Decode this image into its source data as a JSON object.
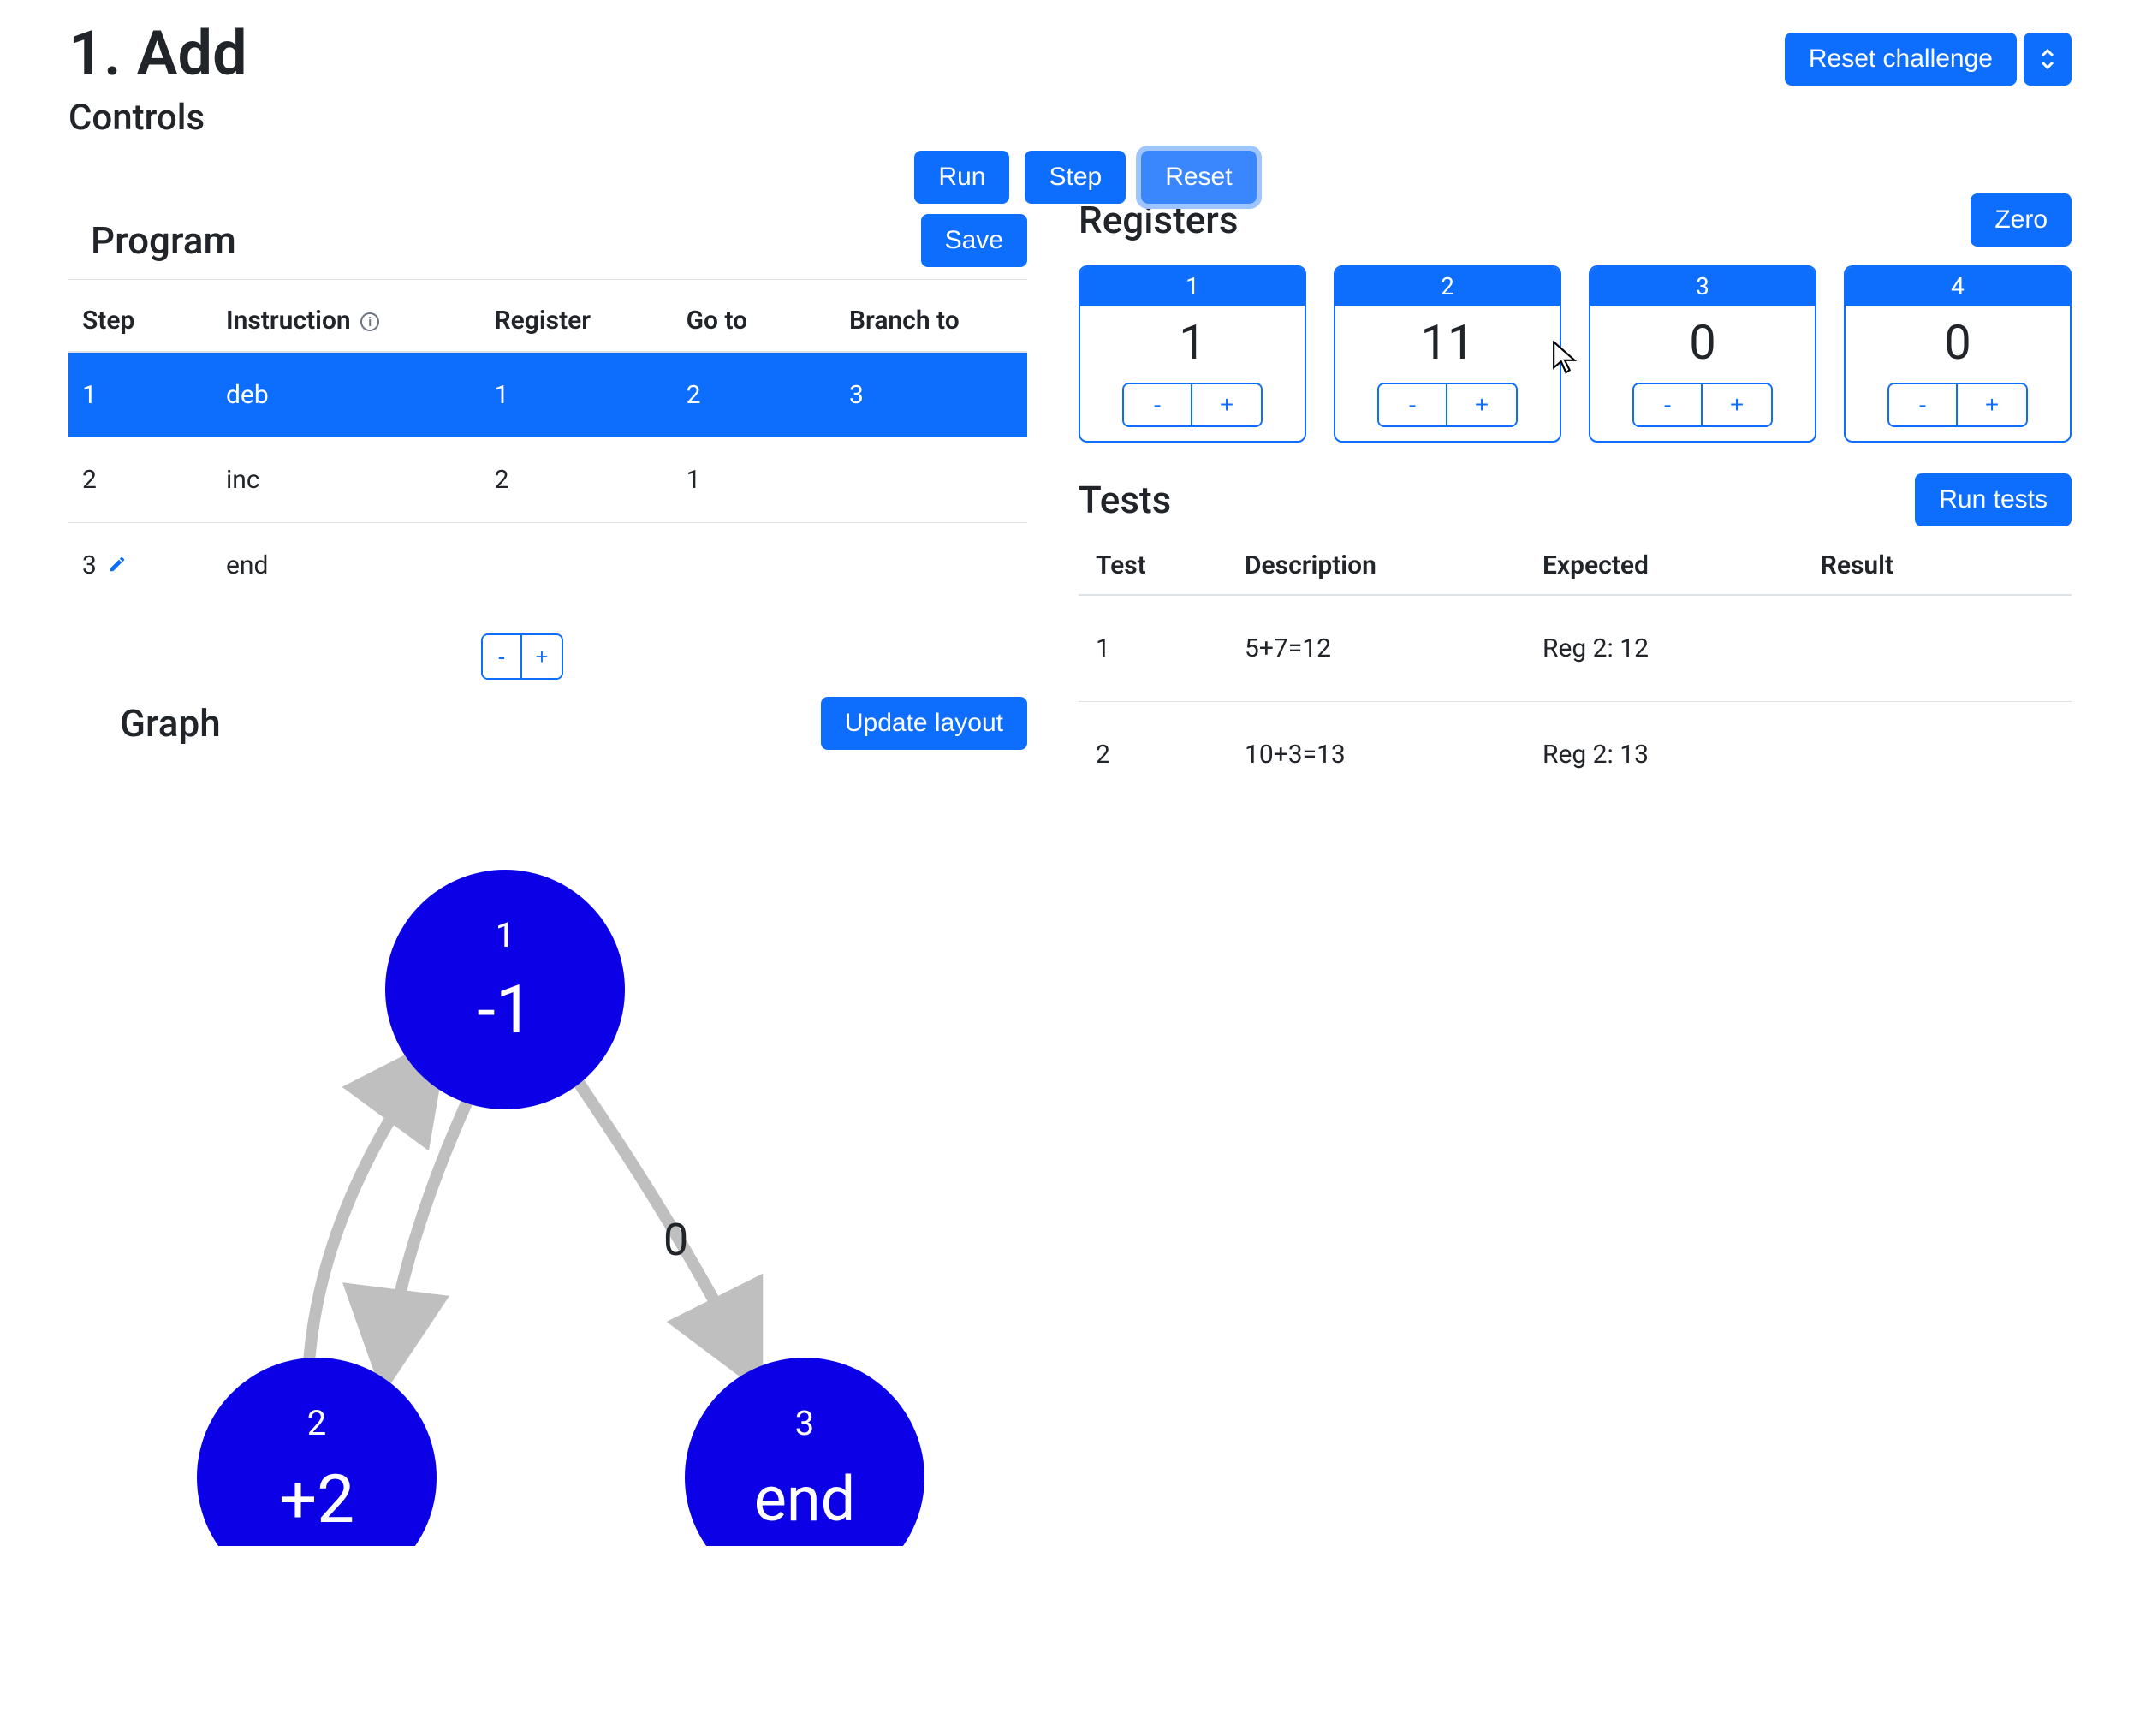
{
  "header": {
    "title": "1. Add",
    "subtitle": "Controls",
    "reset_challenge_label": "Reset challenge"
  },
  "controls": {
    "run_label": "Run",
    "step_label": "Step",
    "reset_label": "Reset",
    "save_label": "Save"
  },
  "program": {
    "heading": "Program",
    "columns": {
      "step": "Step",
      "instruction": "Instruction",
      "register": "Register",
      "goto": "Go to",
      "branchto": "Branch to"
    },
    "rows": [
      {
        "step": "1",
        "instruction": "deb",
        "register": "1",
        "goto": "2",
        "branchto": "3",
        "selected": true,
        "editing": false
      },
      {
        "step": "2",
        "instruction": "inc",
        "register": "2",
        "goto": "1",
        "branchto": "",
        "selected": false,
        "editing": false
      },
      {
        "step": "3",
        "instruction": "end",
        "register": "",
        "goto": "",
        "branchto": "",
        "selected": false,
        "editing": true
      }
    ],
    "minus": "-",
    "plus": "+"
  },
  "graph": {
    "heading": "Graph",
    "update_layout_label": "Update layout",
    "edge_label_0": "0",
    "nodes": [
      {
        "id": "1",
        "label": "-1"
      },
      {
        "id": "2",
        "label": "+2"
      },
      {
        "id": "3",
        "label": "end"
      }
    ]
  },
  "registers": {
    "heading": "Registers",
    "zero_label": "Zero",
    "minus": "-",
    "plus": "+",
    "items": [
      {
        "id": "1",
        "value": "1"
      },
      {
        "id": "2",
        "value": "11"
      },
      {
        "id": "3",
        "value": "0"
      },
      {
        "id": "4",
        "value": "0"
      }
    ]
  },
  "tests": {
    "heading": "Tests",
    "run_tests_label": "Run tests",
    "columns": {
      "test": "Test",
      "description": "Description",
      "expected": "Expected",
      "result": "Result"
    },
    "rows": [
      {
        "test": "1",
        "description": "5+7=12",
        "expected": "Reg 2: 12",
        "result": ""
      },
      {
        "test": "2",
        "description": "10+3=13",
        "expected": "Reg 2: 13",
        "result": ""
      }
    ]
  }
}
